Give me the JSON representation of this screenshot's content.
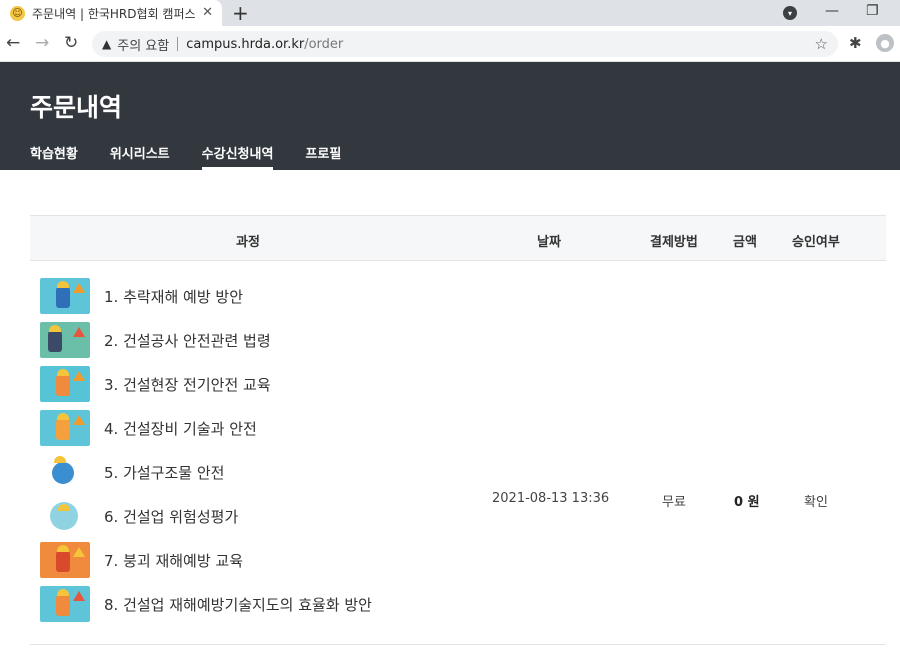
{
  "browser": {
    "tab_title": "주문내역 | 한국HRD협회 캠퍼스",
    "tab_close": "✕",
    "new_tab": "+",
    "security_label": "주의 요함",
    "url_host": "campus.hrda.or.kr",
    "url_path": "/order"
  },
  "header": {
    "title": "주문내역",
    "tabs": [
      {
        "label": "학습현황"
      },
      {
        "label": "위시리스트"
      },
      {
        "label": "수강신청내역",
        "active": true
      },
      {
        "label": "프로필"
      }
    ]
  },
  "table": {
    "columns": {
      "course": "과정",
      "date": "날짜",
      "payment": "결제방법",
      "amount": "금액",
      "approval": "승인여부"
    },
    "courses": [
      {
        "label": "1. 추락재해 예방 방안"
      },
      {
        "label": "2. 건설공사 안전관련 법령"
      },
      {
        "label": "3. 건설현장 전기안전 교육"
      },
      {
        "label": "4. 건설장비 기술과 안전"
      },
      {
        "label": "5. 가설구조물 안전"
      },
      {
        "label": "6. 건설업 위험성평가"
      },
      {
        "label": "7. 붕괴 재해예방 교육"
      },
      {
        "label": "8. 건설업 재해예방기술지도의 효율화 방안"
      }
    ],
    "order": {
      "date": "2021-08-13 13:36",
      "payment": "무료",
      "amount": "0 원",
      "approval": "확인"
    }
  },
  "colors": {
    "header_bg": "#33383f",
    "thumb_sky": "#5ec4d8",
    "thumb_fire": "#f08a3c"
  }
}
